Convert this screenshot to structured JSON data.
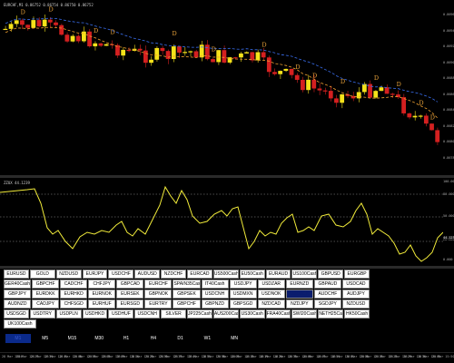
{
  "price_pane": {
    "title": "EURCHF,M1 0.86752 0.86754 0.86750 0.86752",
    "axis_labels": [
      "0.86960",
      "0.86940",
      "0.86920",
      "0.86900",
      "0.86880",
      "0.86860",
      "0.86840",
      "0.86820",
      "0.86800",
      "0.86780"
    ],
    "colors": {
      "bull": "#f5e21a",
      "bear": "#d42020",
      "ma_fast": "#f0a030",
      "ma_slow": "#3a6ff0",
      "marker": "#e8a23a"
    },
    "marker_glyph": "D"
  },
  "osc_pane": {
    "title": "ZZUX 44.1239",
    "axis_labels": [
      "100.000",
      "80.000",
      "50.000",
      "20.000",
      "0.000",
      "44.1239"
    ],
    "colors": {
      "line": "#f2ec3a",
      "level": "#9a9a9a"
    }
  },
  "symbols": [
    [
      "EURUSD",
      "GOLD",
      "NZDUSD",
      "EURJPY",
      "USDCHF",
      "AUDUSD",
      "NZDCHF",
      "EURCAD",
      "US500Cash",
      "EU50Cash",
      "EURAUD",
      "US100Cash",
      "GBPUSD",
      "EURGBP"
    ],
    [
      "GER40Cash",
      "GBPCHF",
      "CADCHF",
      "CHFJPY",
      "GBPCAD",
      "EURCHF",
      "SPAIN35Cash",
      "IT40Cash",
      "USDJPY",
      "USDZAR",
      "EURNZD",
      "GBPAUD",
      "USDCAD"
    ],
    [
      "GBPJPY",
      "EURDKK",
      "EURHKD",
      "EURNOK",
      "EURSEK",
      "GBPNOK",
      "GBPSEK",
      "USDCNH",
      "USDMXN",
      "USDNOK",
      "USDSEK",
      "AUDCHF",
      "AUDJPY"
    ],
    [
      "AUDNZD",
      "CADJPY",
      "CHFSGD",
      "EURHUF",
      "EURSGD",
      "EURTRY",
      "GBPCHF",
      "GBPNZD",
      "GBPSGD",
      "NZDCAD",
      "NZDJPY",
      "SGDJPY",
      "NZDUSD"
    ],
    [
      "USDSGD",
      "USDTRY",
      "USDPLN",
      "USDHKD",
      "USDHUF",
      "USDCNH",
      "SILVER",
      "JP225Cash",
      "AUS200Cash",
      "US30Cash",
      "FRA40Cash",
      "SWI20Cash",
      "NETH25Cash",
      "HK50Cash"
    ],
    [
      "UK100Cash"
    ]
  ],
  "active_symbol": "USDSEK",
  "timeframes": [
    "M1",
    "M5",
    "M15",
    "M30",
    "H1",
    "H4",
    "D1",
    "W1",
    "MN"
  ],
  "active_timeframe": "M1",
  "time_labels": [
    "28 Mar 2024",
    "28 Mar 12:27",
    "28 Mar 12:34",
    "28 Mar 12:41",
    "28 Mar 12:48",
    "28 Mar 12:55",
    "28 Mar 13:02",
    "28 Mar 13:09",
    "28 Mar 13:16",
    "28 Mar 13:23",
    "28 Mar 13:30",
    "28 Mar 13:37",
    "28 Mar 13:44",
    "28 Mar 13:51",
    "28 Mar 13:58",
    "28 Mar 14:05",
    "28 Mar 14:12",
    "28 Mar 14:19",
    "28 Mar 14:26",
    "28 Mar 14:33",
    "28 Mar 14:40",
    "28 Mar 14:47",
    "28 Mar 14:54",
    "28 Mar 15:01",
    "28 Mar 15:08",
    "28 Mar 15:15",
    "28 Mar 15:22",
    "28 Mar 15:29",
    "28 Mar 15:36",
    "28 Mar 15:43",
    "28 Mar 15:50"
  ]
}
